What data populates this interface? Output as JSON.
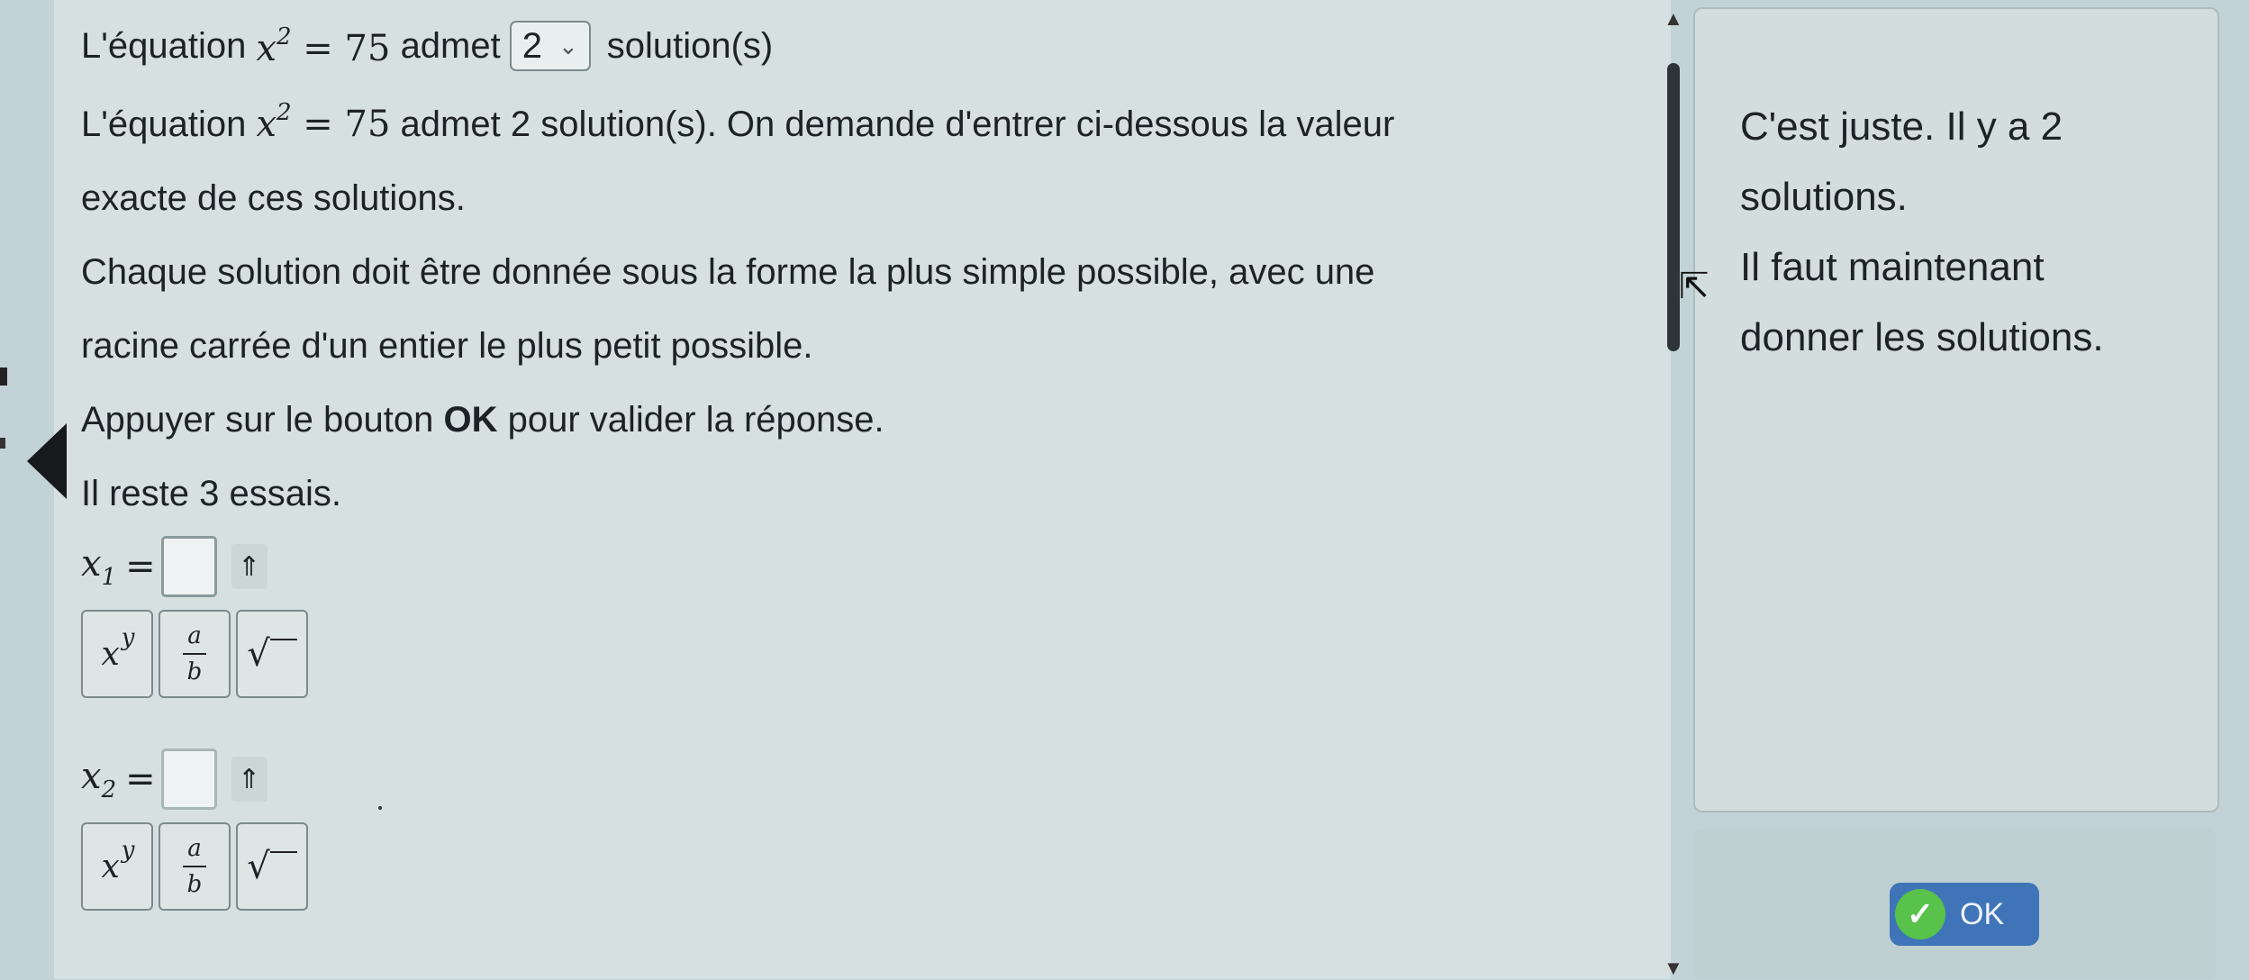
{
  "question": {
    "title_prefix": "L'équation",
    "equation_lhs": "x",
    "equation_exp": "2",
    "equation_rhs": " = 75",
    "title_mid": "admet",
    "select_value": "2",
    "title_suffix": "solution(s)",
    "para1_prefix": "L'équation",
    "para1_rest": " admet 2 solution(s). On demande d'entrer ci-dessous la valeur",
    "para1_line2": "exacte de ces solutions.",
    "para2_line1": "Chaque solution doit être donnée sous la forme la plus simple possible, avec une",
    "para2_line2": "racine carrée d'un entier le plus petit possible.",
    "para3_prefix": "Appuyer sur le bouton ",
    "para3_bold": "OK",
    "para3_suffix": " pour valider la réponse.",
    "attempts": "Il reste 3 essais."
  },
  "answers": [
    {
      "var": "x",
      "sub": "1",
      "eq": "=",
      "value": "",
      "toggle_icon": "⇑"
    },
    {
      "var": "x",
      "sub": "2",
      "eq": "=",
      "value": "",
      "toggle_icon": "⇑"
    }
  ],
  "toolbar": {
    "power_base": "x",
    "power_exp": "y",
    "frac_num": "a",
    "frac_den": "b",
    "sqrt_symbol": "√"
  },
  "feedback": {
    "line1": "C'est juste. Il y a 2",
    "line2": "solutions.",
    "line3": "Il faut maintenant",
    "line4": "donner les solutions."
  },
  "ok_button": {
    "label": "OK"
  },
  "colors": {
    "ok_bg": "#3f74b8",
    "check_bg": "#58c24a"
  }
}
